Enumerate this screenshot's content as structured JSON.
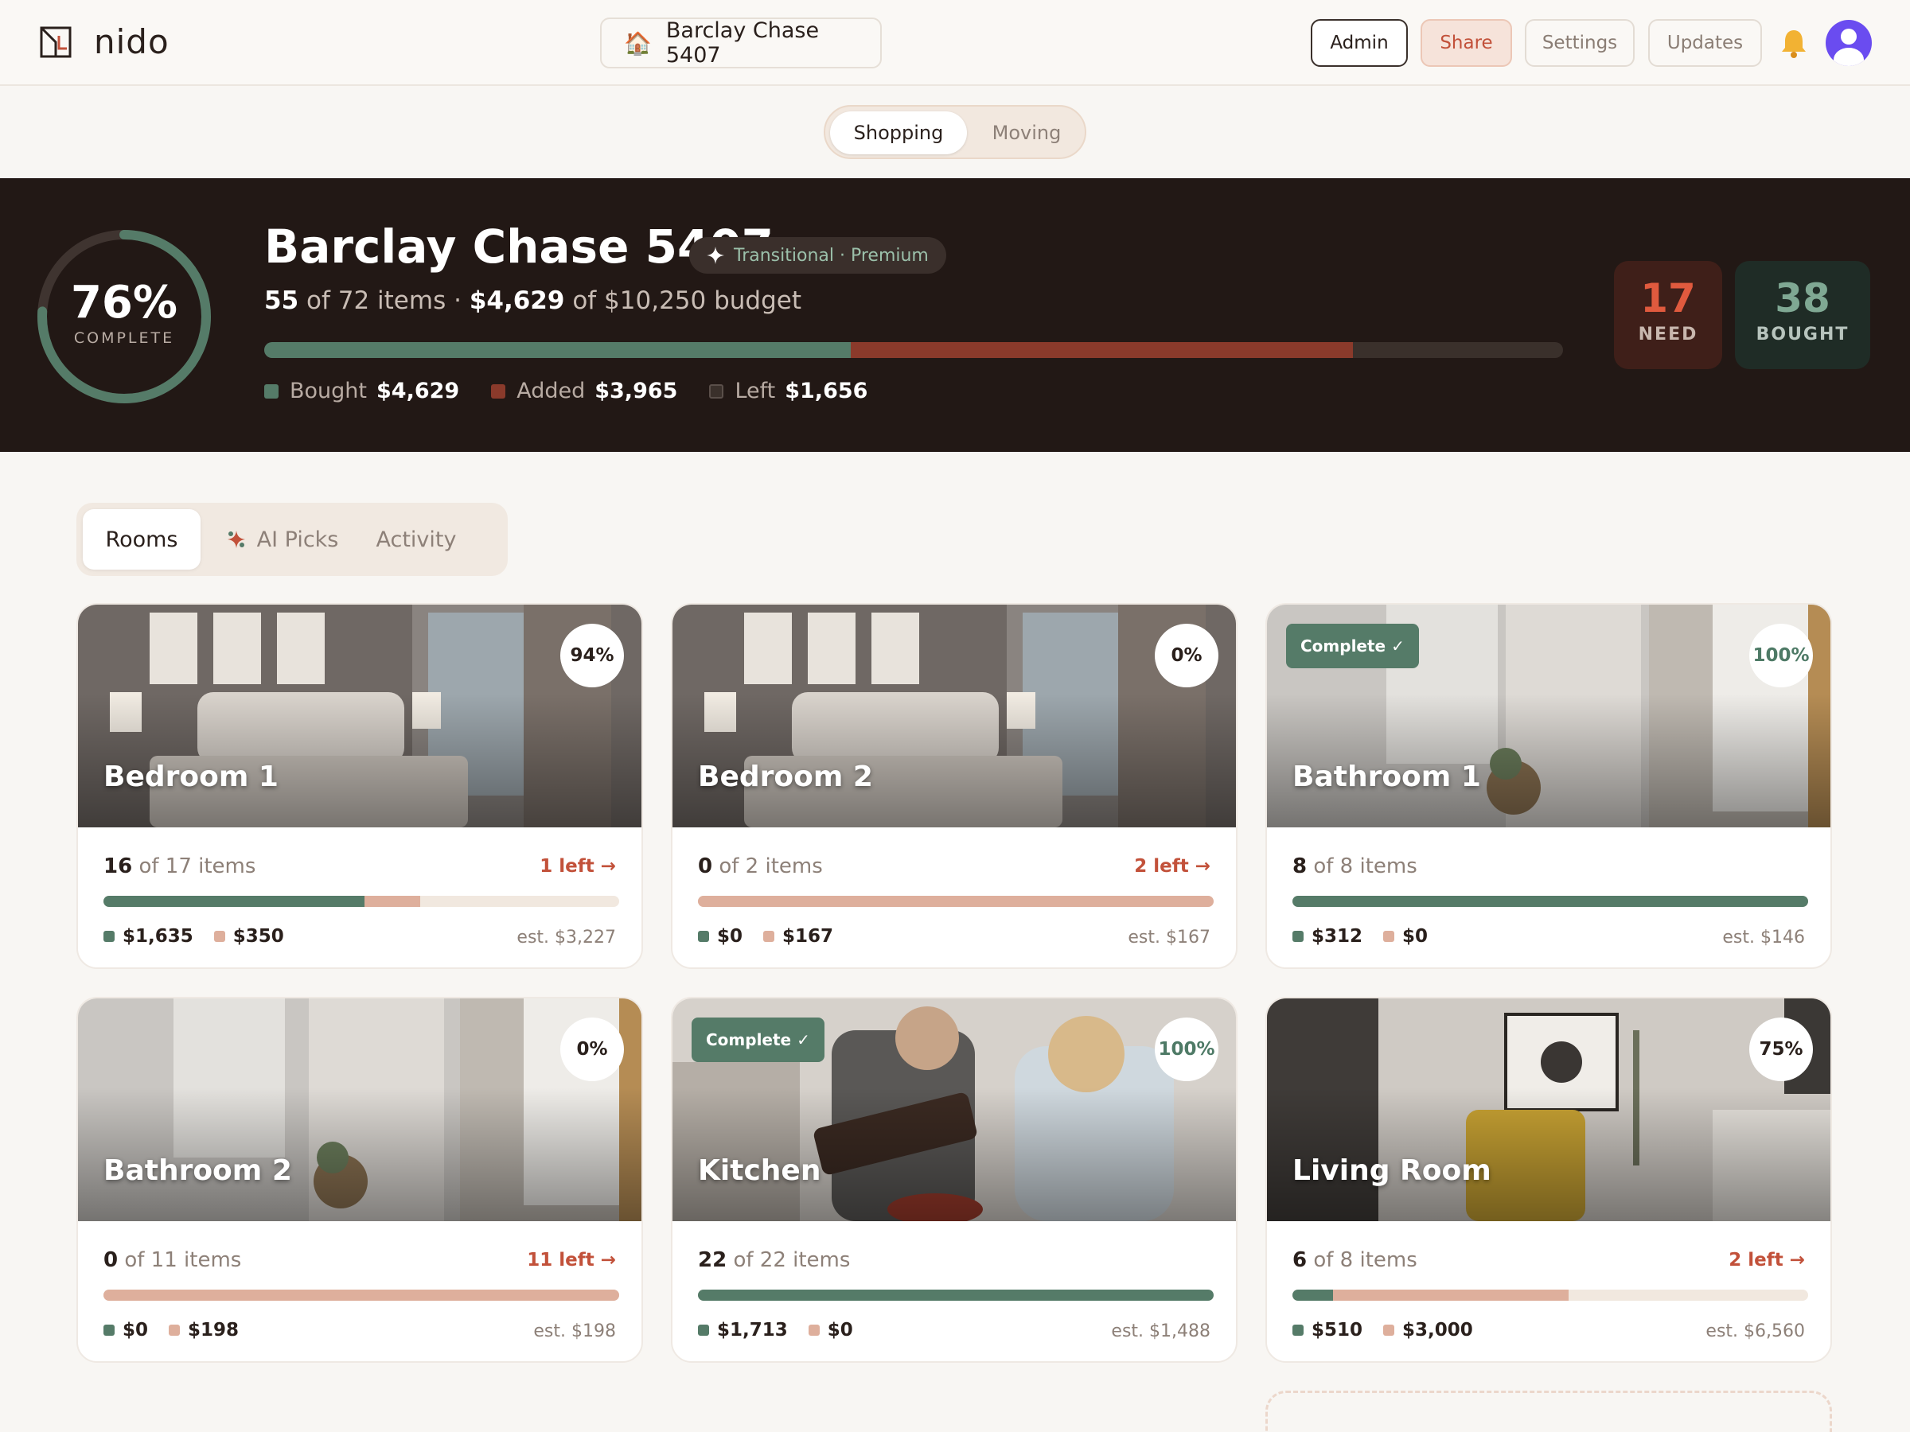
{
  "app": {
    "name": "nido"
  },
  "project": {
    "name": "Barclay Chase 5407",
    "icon": "house-icon"
  },
  "toolbar": {
    "admin": "Admin",
    "share": "Share",
    "settings": "Settings",
    "updates": "Updates"
  },
  "mode": {
    "options": [
      "Shopping",
      "Moving"
    ],
    "selected": "Shopping"
  },
  "hero": {
    "percent": "76%",
    "percent_value": 0.76,
    "complete_label": "COMPLETE",
    "title": "Barclay Chase 5407",
    "style_tag": "Transitional · Premium",
    "items_bought": "55",
    "items_text": "of 72 items",
    "sep": "·",
    "spent": "$4,629",
    "budget_text": "of $10,250 budget",
    "legend": {
      "bought_label": "Bought",
      "bought_value": "$4,629",
      "added_label": "Added",
      "added_value": "$3,965",
      "left_label": "Left",
      "left_value": "$1,656"
    },
    "budget_bar": {
      "total": 10250,
      "bought": 4629,
      "added": 3965
    },
    "need_count": "17",
    "need_label": "NEED",
    "bought_count": "38",
    "bought_label": "BOUGHT"
  },
  "tabs": {
    "rooms": "Rooms",
    "ai_picks": "AI Picks",
    "activity": "Activity",
    "selected": "Rooms"
  },
  "rooms": [
    {
      "name": "Bedroom 1",
      "pct": "94%",
      "complete": "",
      "bought": "16",
      "total_text": "of 17 items",
      "left": "1 left →",
      "bought_frac": 0.506,
      "added_frac": 0.108,
      "spent": "$1,635",
      "added": "$350",
      "est": "est. $3,227"
    },
    {
      "name": "Bedroom 2",
      "pct": "0%",
      "complete": "",
      "bought": "0",
      "total_text": "of 2 items",
      "left": "2 left →",
      "bought_frac": 0,
      "added_frac": 1,
      "spent": "$0",
      "added": "$167",
      "est": "est. $167"
    },
    {
      "name": "Bathroom 1",
      "pct": "100%",
      "complete": "Complete ✓",
      "bought": "8",
      "total_text": "of 8 items",
      "left": "",
      "bought_frac": 1,
      "added_frac": 0,
      "spent": "$312",
      "added": "$0",
      "est": "est. $146"
    },
    {
      "name": "Bathroom 2",
      "pct": "0%",
      "complete": "",
      "bought": "0",
      "total_text": "of 11 items",
      "left": "11 left →",
      "bought_frac": 0,
      "added_frac": 1,
      "spent": "$0",
      "added": "$198",
      "est": "est. $198"
    },
    {
      "name": "Kitchen",
      "pct": "100%",
      "complete": "Complete ✓",
      "bought": "22",
      "total_text": "of 22 items",
      "left": "",
      "bought_frac": 1,
      "added_frac": 0,
      "spent": "$1,713",
      "added": "$0",
      "est": "est. $1,488"
    },
    {
      "name": "Living Room",
      "pct": "75%",
      "complete": "",
      "bought": "6",
      "total_text": "of 8 items",
      "left": "2 left →",
      "bought_frac": 0.078,
      "added_frac": 0.457,
      "spent": "$510",
      "added": "$3,000",
      "est": "est. $6,560"
    }
  ],
  "colors": {
    "bought": "#557b68",
    "added": "#8a3a2b",
    "left": "#3a302b",
    "accent": "#c2513a"
  }
}
